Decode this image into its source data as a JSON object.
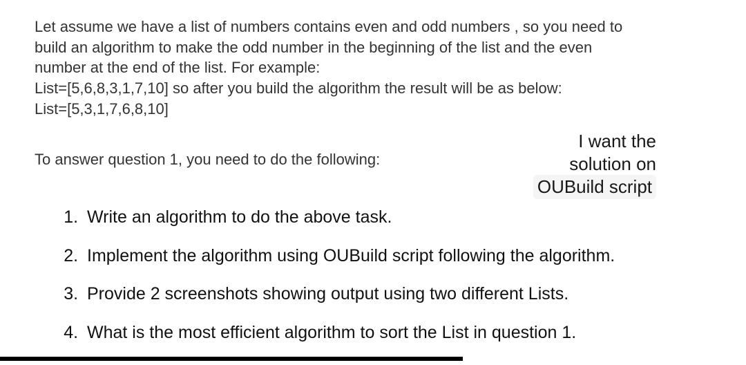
{
  "intro": {
    "p1": "Let assume we have a list of numbers contains even and odd numbers , so you need to",
    "p2": "build an algorithm to make the odd number in the beginning of the list and the even",
    "p3": "number at the end of the list. For example:",
    "p4": "List=[5,6,8,3,1,7,10] so after you build the algorithm the result will be as below:",
    "p5": "List=[5,3,1,7,6,8,10]"
  },
  "follow_text": "To answer question 1, you need to do the following:",
  "callout": {
    "line1": "I want the",
    "line2": "solution on",
    "line3": "OUBuild script"
  },
  "tasks": [
    "Write an algorithm to do the above task.",
    "Implement the algorithm using OUBuild script following the algorithm.",
    "Provide 2 screenshots showing output using two different Lists.",
    "What is the most efficient algorithm to sort the List in question 1."
  ]
}
